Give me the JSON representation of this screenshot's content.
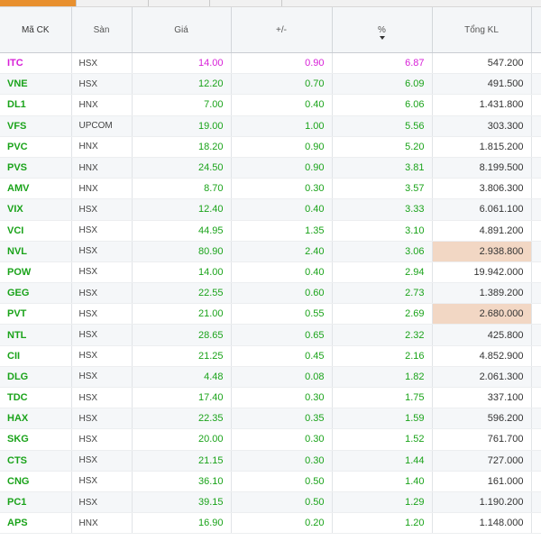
{
  "colors": {
    "ceiling": "#d81fd8",
    "up": "#1aa31a",
    "highlight": "#f2d7c4",
    "header_bg": "#f4f6f8",
    "tab_accent": "#e8902f"
  },
  "table": {
    "headers": {
      "symbol": "Mã CK",
      "exchange": "Sàn",
      "price": "Giá",
      "change": "+/-",
      "percent": "%",
      "volume": "Tổng KL"
    },
    "sort": {
      "column": "percent",
      "direction": "desc"
    },
    "rows": [
      {
        "symbol": "ITC",
        "exchange": "HSX",
        "price": "14.00",
        "change": "0.90",
        "percent": "6.87",
        "volume": "547.200",
        "status": "ceiling",
        "highlight": false
      },
      {
        "symbol": "VNE",
        "exchange": "HSX",
        "price": "12.20",
        "change": "0.70",
        "percent": "6.09",
        "volume": "491.500",
        "status": "up",
        "highlight": false
      },
      {
        "symbol": "DL1",
        "exchange": "HNX",
        "price": "7.00",
        "change": "0.40",
        "percent": "6.06",
        "volume": "1.431.800",
        "status": "up",
        "highlight": false
      },
      {
        "symbol": "VFS",
        "exchange": "UPCOM",
        "price": "19.00",
        "change": "1.00",
        "percent": "5.56",
        "volume": "303.300",
        "status": "up",
        "highlight": false
      },
      {
        "symbol": "PVC",
        "exchange": "HNX",
        "price": "18.20",
        "change": "0.90",
        "percent": "5.20",
        "volume": "1.815.200",
        "status": "up",
        "highlight": false
      },
      {
        "symbol": "PVS",
        "exchange": "HNX",
        "price": "24.50",
        "change": "0.90",
        "percent": "3.81",
        "volume": "8.199.500",
        "status": "up",
        "highlight": false
      },
      {
        "symbol": "AMV",
        "exchange": "HNX",
        "price": "8.70",
        "change": "0.30",
        "percent": "3.57",
        "volume": "3.806.300",
        "status": "up",
        "highlight": false
      },
      {
        "symbol": "VIX",
        "exchange": "HSX",
        "price": "12.40",
        "change": "0.40",
        "percent": "3.33",
        "volume": "6.061.100",
        "status": "up",
        "highlight": false
      },
      {
        "symbol": "VCI",
        "exchange": "HSX",
        "price": "44.95",
        "change": "1.35",
        "percent": "3.10",
        "volume": "4.891.200",
        "status": "up",
        "highlight": false
      },
      {
        "symbol": "NVL",
        "exchange": "HSX",
        "price": "80.90",
        "change": "2.40",
        "percent": "3.06",
        "volume": "2.938.800",
        "status": "up",
        "highlight": true
      },
      {
        "symbol": "POW",
        "exchange": "HSX",
        "price": "14.00",
        "change": "0.40",
        "percent": "2.94",
        "volume": "19.942.000",
        "status": "up",
        "highlight": false
      },
      {
        "symbol": "GEG",
        "exchange": "HSX",
        "price": "22.55",
        "change": "0.60",
        "percent": "2.73",
        "volume": "1.389.200",
        "status": "up",
        "highlight": false
      },
      {
        "symbol": "PVT",
        "exchange": "HSX",
        "price": "21.00",
        "change": "0.55",
        "percent": "2.69",
        "volume": "2.680.000",
        "status": "up",
        "highlight": true
      },
      {
        "symbol": "NTL",
        "exchange": "HSX",
        "price": "28.65",
        "change": "0.65",
        "percent": "2.32",
        "volume": "425.800",
        "status": "up",
        "highlight": false
      },
      {
        "symbol": "CII",
        "exchange": "HSX",
        "price": "21.25",
        "change": "0.45",
        "percent": "2.16",
        "volume": "4.852.900",
        "status": "up",
        "highlight": false
      },
      {
        "symbol": "DLG",
        "exchange": "HSX",
        "price": "4.48",
        "change": "0.08",
        "percent": "1.82",
        "volume": "2.061.300",
        "status": "up",
        "highlight": false
      },
      {
        "symbol": "TDC",
        "exchange": "HSX",
        "price": "17.40",
        "change": "0.30",
        "percent": "1.75",
        "volume": "337.100",
        "status": "up",
        "highlight": false
      },
      {
        "symbol": "HAX",
        "exchange": "HSX",
        "price": "22.35",
        "change": "0.35",
        "percent": "1.59",
        "volume": "596.200",
        "status": "up",
        "highlight": false
      },
      {
        "symbol": "SKG",
        "exchange": "HSX",
        "price": "20.00",
        "change": "0.30",
        "percent": "1.52",
        "volume": "761.700",
        "status": "up",
        "highlight": false
      },
      {
        "symbol": "CTS",
        "exchange": "HSX",
        "price": "21.15",
        "change": "0.30",
        "percent": "1.44",
        "volume": "727.000",
        "status": "up",
        "highlight": false
      },
      {
        "symbol": "CNG",
        "exchange": "HSX",
        "price": "36.10",
        "change": "0.50",
        "percent": "1.40",
        "volume": "161.000",
        "status": "up",
        "highlight": false
      },
      {
        "symbol": "PC1",
        "exchange": "HSX",
        "price": "39.15",
        "change": "0.50",
        "percent": "1.29",
        "volume": "1.190.200",
        "status": "up",
        "highlight": false
      },
      {
        "symbol": "APS",
        "exchange": "HNX",
        "price": "16.90",
        "change": "0.20",
        "percent": "1.20",
        "volume": "1.148.000",
        "status": "up",
        "highlight": false
      }
    ]
  }
}
